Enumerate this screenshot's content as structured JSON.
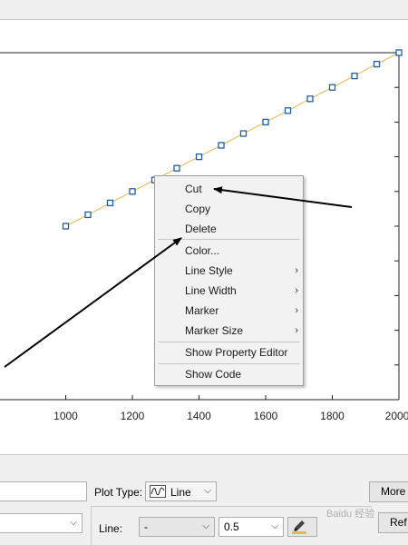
{
  "chart_data": {
    "type": "line",
    "x": [
      1000,
      1066.67,
      1133.33,
      1200,
      1266.67,
      1333.33,
      1400,
      1466.67,
      1533.33,
      1600,
      1666.67,
      1733.33,
      1800,
      1866.67,
      1933.33,
      2000
    ],
    "y": [
      5,
      5.33,
      5.67,
      6,
      6.33,
      6.67,
      7,
      7.33,
      7.67,
      8,
      8.33,
      8.67,
      9,
      9.33,
      9.67,
      10
    ],
    "xticks": [
      "1000",
      "1200",
      "1400",
      "1600",
      "1800",
      "2000"
    ],
    "xlim": [
      800,
      2000
    ],
    "ylim": [
      0,
      10
    ],
    "line_color": "#e8b84a",
    "marker_color": "#1f5fa8",
    "marker": "square",
    "grid": false
  },
  "context_menu": {
    "items": [
      {
        "label": "Cut",
        "submenu": false
      },
      {
        "label": "Copy",
        "submenu": false
      },
      {
        "label": "Delete",
        "submenu": false
      },
      {
        "label": "Color...",
        "submenu": false
      },
      {
        "label": "Line Style",
        "submenu": true
      },
      {
        "label": "Line Width",
        "submenu": true
      },
      {
        "label": "Marker",
        "submenu": true
      },
      {
        "label": "Marker Size",
        "submenu": true
      },
      {
        "label": "Show Property Editor",
        "submenu": false
      },
      {
        "label": "Show Code",
        "submenu": false
      }
    ],
    "chevron": "›"
  },
  "bottom_panel": {
    "plot_type_label": "Plot Type:",
    "plot_type_value": "Line",
    "line_label": "Line:",
    "line_style_value": "-",
    "line_width_value": "0.5",
    "more_button": "More",
    "ref_button": "Ref",
    "dropdown_glyph": "⌵",
    "watermark": "Baidu 经验"
  }
}
